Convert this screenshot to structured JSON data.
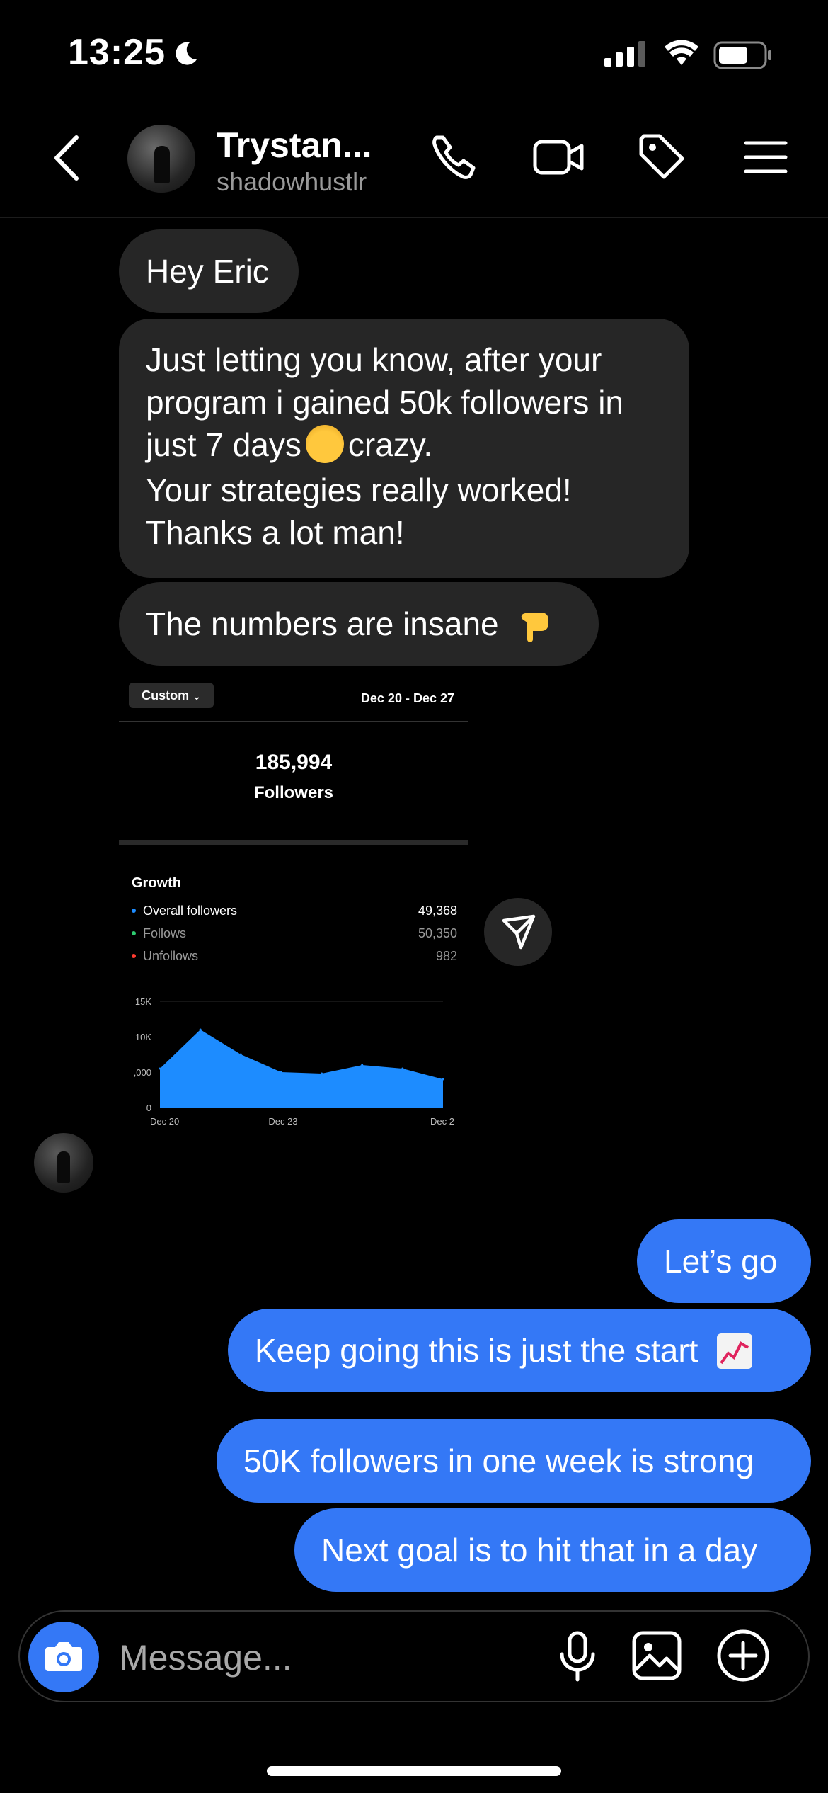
{
  "status_bar": {
    "time": "13:25"
  },
  "header": {
    "name": "Trystan...",
    "username": "shadowhustlr"
  },
  "messages": {
    "received": [
      "Hey Eric",
      "Just letting you know, after your",
      "program i gained 50k followers in",
      "just 7 days",
      "crazy.",
      "Your strategies really worked!",
      "Thanks a lot man!",
      "The numbers are insane"
    ],
    "sent": [
      "Let’s go",
      "Keep going this is just the start",
      "50K followers in one week is strong",
      "Next goal is to hit that in a day"
    ]
  },
  "screenshot": {
    "filter": "Custom",
    "date_range": "Dec 20 - Dec 27",
    "total": "185,994",
    "total_label": "Followers",
    "section_title": "Growth",
    "legend": [
      {
        "label": "Overall followers",
        "value": "49,368",
        "color": "#1d8cff"
      },
      {
        "label": "Follows",
        "value": "50,350",
        "color": "#2ecc71"
      },
      {
        "label": "Unfollows",
        "value": "982",
        "color": "#ff3b30"
      }
    ]
  },
  "chart_data": {
    "type": "area",
    "x": [
      "Dec 20",
      "Dec 21",
      "Dec 22",
      "Dec 23",
      "Dec 24",
      "Dec 25",
      "Dec 26",
      "Dec 27"
    ],
    "values": [
      5500,
      11000,
      7500,
      5000,
      4800,
      6000,
      5500,
      4000
    ],
    "x_tick_labels": [
      "Dec 20",
      "Dec 23",
      "Dec 2"
    ],
    "y_tick_labels": [
      "15K",
      "10K",
      ",000",
      "0"
    ],
    "ylim": [
      0,
      15000
    ],
    "color": "#1d8cff",
    "grid": true
  },
  "composer": {
    "placeholder": "Message..."
  },
  "colors": {
    "accent": "#3478f6",
    "bubble_received": "#262626",
    "background": "#000000"
  },
  "icons": [
    "moon-icon",
    "signal-icon",
    "wifi-icon",
    "battery-icon",
    "back-icon",
    "phone-icon",
    "video-icon",
    "tag-icon",
    "menu-icon",
    "send-icon",
    "camera-icon",
    "microphone-icon",
    "gallery-icon",
    "plus-icon"
  ]
}
